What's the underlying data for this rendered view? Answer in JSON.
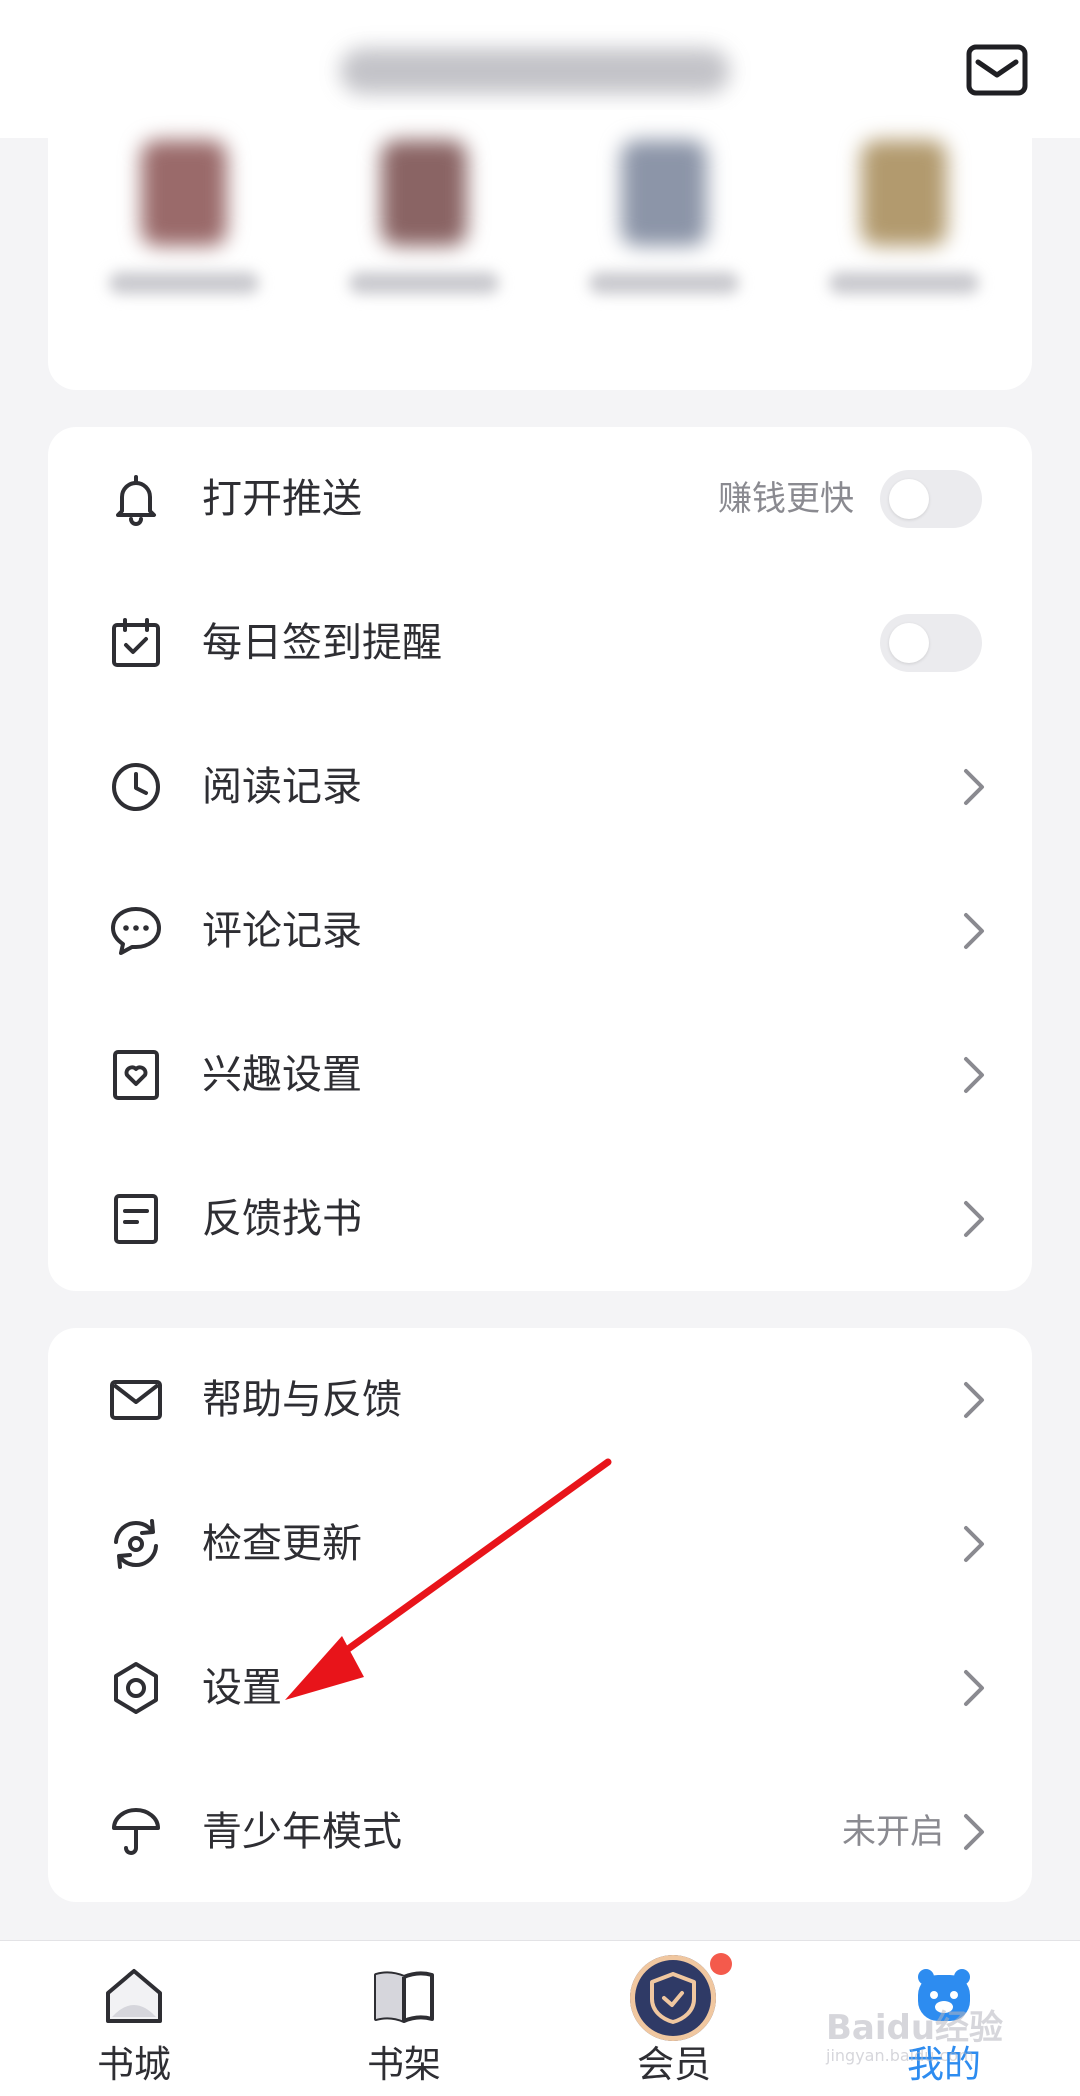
{
  "header": {
    "icon": "mail-icon"
  },
  "settings_group1": [
    {
      "label": "打开推送",
      "icon": "bell-icon",
      "note": "赚钱更快",
      "control": "toggle",
      "toggle_on": false
    },
    {
      "label": "每日签到提醒",
      "icon": "calendar-check-icon",
      "control": "toggle",
      "toggle_on": false
    },
    {
      "label": "阅读记录",
      "icon": "clock-icon",
      "control": "chevron"
    },
    {
      "label": "评论记录",
      "icon": "chat-bubble-icon",
      "control": "chevron"
    },
    {
      "label": "兴趣设置",
      "icon": "heart-frame-icon",
      "control": "chevron"
    },
    {
      "label": "反馈找书",
      "icon": "document-icon",
      "control": "chevron"
    }
  ],
  "settings_group2": [
    {
      "label": "帮助与反馈",
      "icon": "envelope-icon",
      "control": "chevron"
    },
    {
      "label": "检查更新",
      "icon": "refresh-icon",
      "control": "chevron"
    },
    {
      "label": "设置",
      "icon": "gear-icon",
      "control": "chevron"
    },
    {
      "label": "青少年模式",
      "icon": "umbrella-icon",
      "note": "未开启",
      "control": "chevron"
    }
  ],
  "tabs": [
    {
      "label": "书城",
      "icon": "bookstore-icon",
      "active": false
    },
    {
      "label": "书架",
      "icon": "bookshelf-icon",
      "active": false
    },
    {
      "label": "会员",
      "icon": "vip-shield-icon",
      "active": false,
      "badge_dot": true
    },
    {
      "label": "我的",
      "icon": "profile-mascot-icon",
      "active": true
    }
  ],
  "colors": {
    "accent": "#2d8cf0",
    "annotation_arrow": "#e8141a",
    "badge": "#f45a4c",
    "page_bg": "#f4f4f6"
  },
  "watermark": {
    "main": "Baidu经验",
    "sub": "jingyan.baidu.com"
  }
}
